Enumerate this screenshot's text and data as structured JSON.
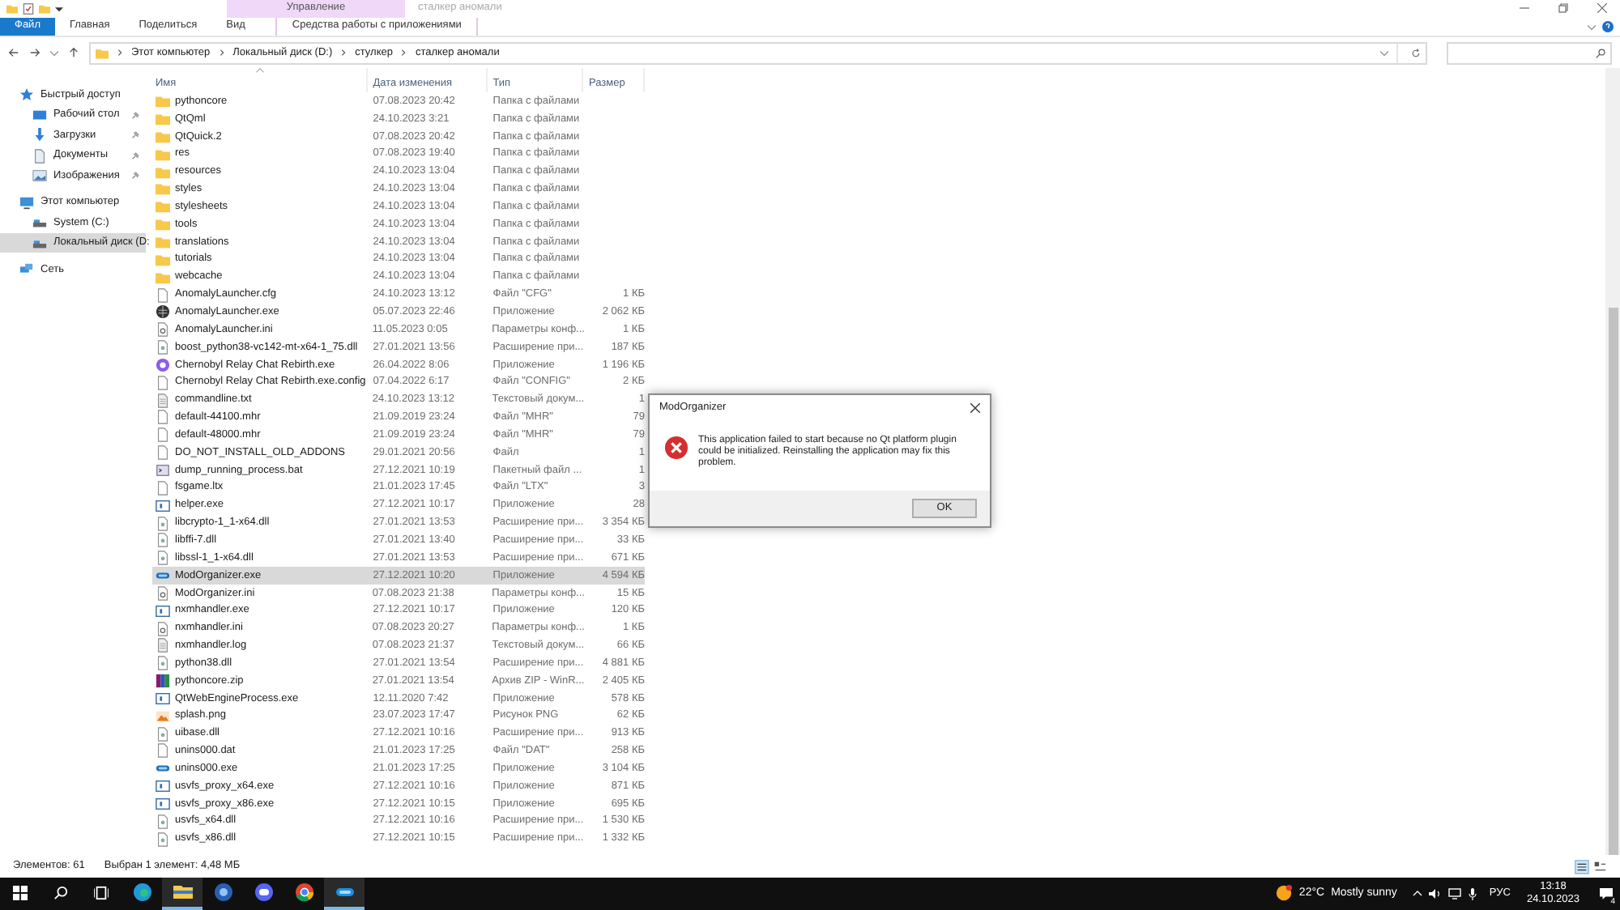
{
  "window": {
    "context_tab": "Управление",
    "title": "сталкер аномали"
  },
  "ribbon": {
    "tabs": [
      {
        "label": "Файл",
        "selected": true
      },
      {
        "label": "Главная",
        "selected": false
      },
      {
        "label": "Поделиться",
        "selected": false
      },
      {
        "label": "Вид",
        "selected": false
      },
      {
        "label": "Средства работы с приложениями",
        "selected": false
      }
    ]
  },
  "address": {
    "crumbs": [
      "Этот компьютер",
      "Локальный диск (D:)",
      "стулкер",
      "сталкер аномали"
    ]
  },
  "sidebar": {
    "items": [
      {
        "label": "Быстрый доступ",
        "kind": "star",
        "pinned": false,
        "selected": false,
        "children": [
          {
            "label": "Рабочий стол",
            "kind": "desktop",
            "pinned": true,
            "selected": false
          },
          {
            "label": "Загрузки",
            "kind": "download",
            "pinned": true,
            "selected": false
          },
          {
            "label": "Документы",
            "kind": "docs",
            "pinned": true,
            "selected": false
          },
          {
            "label": "Изображения",
            "kind": "pictures",
            "pinned": true,
            "selected": false
          }
        ]
      },
      {
        "label": "Этот компьютер",
        "kind": "computer",
        "pinned": false,
        "selected": false,
        "children": [
          {
            "label": "System (C:)",
            "kind": "drive",
            "pinned": false,
            "selected": false
          },
          {
            "label": "Локальный диск (D:",
            "kind": "drive",
            "pinned": false,
            "selected": true
          }
        ]
      },
      {
        "label": "Сеть",
        "kind": "network",
        "pinned": false,
        "selected": false
      }
    ]
  },
  "table": {
    "columns": [
      "Имя",
      "Дата изменения",
      "Тип",
      "Размер"
    ],
    "rows": [
      {
        "name": "pythoncore",
        "date": "07.08.2023 20:42",
        "type": "Папка с файлами",
        "size": "",
        "kind": "folder",
        "selected": false
      },
      {
        "name": "QtQml",
        "date": "24.10.2023 3:21",
        "type": "Папка с файлами",
        "size": "",
        "kind": "folder",
        "selected": false
      },
      {
        "name": "QtQuick.2",
        "date": "07.08.2023 20:42",
        "type": "Папка с файлами",
        "size": "",
        "kind": "folder",
        "selected": false
      },
      {
        "name": "res",
        "date": "07.08.2023 19:40",
        "type": "Папка с файлами",
        "size": "",
        "kind": "folder",
        "selected": false
      },
      {
        "name": "resources",
        "date": "24.10.2023 13:04",
        "type": "Папка с файлами",
        "size": "",
        "kind": "folder",
        "selected": false
      },
      {
        "name": "styles",
        "date": "24.10.2023 13:04",
        "type": "Папка с файлами",
        "size": "",
        "kind": "folder",
        "selected": false
      },
      {
        "name": "stylesheets",
        "date": "24.10.2023 13:04",
        "type": "Папка с файлами",
        "size": "",
        "kind": "folder",
        "selected": false
      },
      {
        "name": "tools",
        "date": "24.10.2023 13:04",
        "type": "Папка с файлами",
        "size": "",
        "kind": "folder",
        "selected": false
      },
      {
        "name": "translations",
        "date": "24.10.2023 13:04",
        "type": "Папка с файлами",
        "size": "",
        "kind": "folder",
        "selected": false
      },
      {
        "name": "tutorials",
        "date": "24.10.2023 13:04",
        "type": "Папка с файлами",
        "size": "",
        "kind": "folder",
        "selected": false
      },
      {
        "name": "webcache",
        "date": "24.10.2023 13:04",
        "type": "Папка с файлами",
        "size": "",
        "kind": "folder",
        "selected": false
      },
      {
        "name": "AnomalyLauncher.cfg",
        "date": "24.10.2023 13:12",
        "type": "Файл \"CFG\"",
        "size": "1 КБ",
        "kind": "file",
        "selected": false
      },
      {
        "name": "AnomalyLauncher.exe",
        "date": "05.07.2023 22:46",
        "type": "Приложение",
        "size": "2 062 КБ",
        "kind": "globe",
        "selected": false
      },
      {
        "name": "AnomalyLauncher.ini",
        "date": "11.05.2023 0:05",
        "type": "Параметры конф...",
        "size": "1 КБ",
        "kind": "settings",
        "selected": false
      },
      {
        "name": "boost_python38-vc142-mt-x64-1_75.dll",
        "date": "27.01.2021 13:56",
        "type": "Расширение при...",
        "size": "187 КБ",
        "kind": "library",
        "selected": false
      },
      {
        "name": "Chernobyl Relay Chat Rebirth.exe",
        "date": "26.04.2022 8:06",
        "type": "Приложение",
        "size": "1 196 КБ",
        "kind": "chat",
        "selected": false
      },
      {
        "name": "Chernobyl Relay Chat Rebirth.exe.config",
        "date": "07.04.2022 6:17",
        "type": "Файл \"CONFIG\"",
        "size": "2 КБ",
        "kind": "file",
        "selected": false
      },
      {
        "name": "commandline.txt",
        "date": "24.10.2023 13:12",
        "type": "Текстовый докум...",
        "size": "1",
        "kind": "text",
        "selected": false
      },
      {
        "name": "default-44100.mhr",
        "date": "21.09.2019 23:24",
        "type": "Файл \"MHR\"",
        "size": "79",
        "kind": "file",
        "selected": false
      },
      {
        "name": "default-48000.mhr",
        "date": "21.09.2019 23:24",
        "type": "Файл \"MHR\"",
        "size": "79",
        "kind": "file",
        "selected": false
      },
      {
        "name": "DO_NOT_INSTALL_OLD_ADDONS",
        "date": "29.01.2021 20:56",
        "type": "Файл",
        "size": "1",
        "kind": "file",
        "selected": false
      },
      {
        "name": "dump_running_process.bat",
        "date": "27.12.2021 10:19",
        "type": "Пакетный файл ...",
        "size": "1",
        "kind": "batch",
        "selected": false
      },
      {
        "name": "fsgame.ltx",
        "date": "21.01.2023 17:45",
        "type": "Файл \"LTX\"",
        "size": "3",
        "kind": "file",
        "selected": false
      },
      {
        "name": "helper.exe",
        "date": "27.12.2021 10:17",
        "type": "Приложение",
        "size": "28",
        "kind": "app",
        "selected": false
      },
      {
        "name": "libcrypto-1_1-x64.dll",
        "date": "27.01.2021 13:53",
        "type": "Расширение при...",
        "size": "3 354 КБ",
        "kind": "library",
        "selected": false
      },
      {
        "name": "libffi-7.dll",
        "date": "27.01.2021 13:40",
        "type": "Расширение при...",
        "size": "33 КБ",
        "kind": "library",
        "selected": false
      },
      {
        "name": "libssl-1_1-x64.dll",
        "date": "27.01.2021 13:53",
        "type": "Расширение при...",
        "size": "671 КБ",
        "kind": "library",
        "selected": false
      },
      {
        "name": "ModOrganizer.exe",
        "date": "27.12.2021 10:20",
        "type": "Приложение",
        "size": "4 594 КБ",
        "kind": "organizer",
        "selected": true
      },
      {
        "name": "ModOrganizer.ini",
        "date": "07.08.2023 21:38",
        "type": "Параметры конф...",
        "size": "15 КБ",
        "kind": "settings",
        "selected": false
      },
      {
        "name": "nxmhandler.exe",
        "date": "27.12.2021 10:17",
        "type": "Приложение",
        "size": "120 КБ",
        "kind": "app",
        "selected": false
      },
      {
        "name": "nxmhandler.ini",
        "date": "07.08.2023 20:27",
        "type": "Параметры конф...",
        "size": "1 КБ",
        "kind": "settings",
        "selected": false
      },
      {
        "name": "nxmhandler.log",
        "date": "07.08.2023 21:37",
        "type": "Текстовый докум...",
        "size": "66 КБ",
        "kind": "text",
        "selected": false
      },
      {
        "name": "python38.dll",
        "date": "27.01.2021 13:54",
        "type": "Расширение при...",
        "size": "4 881 КБ",
        "kind": "library",
        "selected": false
      },
      {
        "name": "pythoncore.zip",
        "date": "27.01.2021 13:54",
        "type": "Архив ZIP - WinR...",
        "size": "2 405 КБ",
        "kind": "archive",
        "selected": false
      },
      {
        "name": "QtWebEngineProcess.exe",
        "date": "12.11.2020 7:42",
        "type": "Приложение",
        "size": "578 КБ",
        "kind": "app",
        "selected": false
      },
      {
        "name": "splash.png",
        "date": "23.07.2023 17:47",
        "type": "Рисунок PNG",
        "size": "62 КБ",
        "kind": "image",
        "selected": false
      },
      {
        "name": "uibase.dll",
        "date": "27.12.2021 10:16",
        "type": "Расширение при...",
        "size": "913 КБ",
        "kind": "library",
        "selected": false
      },
      {
        "name": "unins000.dat",
        "date": "21.01.2023 17:25",
        "type": "Файл \"DAT\"",
        "size": "258 КБ",
        "kind": "file",
        "selected": false
      },
      {
        "name": "unins000.exe",
        "date": "21.01.2023 17:25",
        "type": "Приложение",
        "size": "3 104 КБ",
        "kind": "organizer",
        "selected": false
      },
      {
        "name": "usvfs_proxy_x64.exe",
        "date": "27.12.2021 10:16",
        "type": "Приложение",
        "size": "871 КБ",
        "kind": "app",
        "selected": false
      },
      {
        "name": "usvfs_proxy_x86.exe",
        "date": "27.12.2021 10:15",
        "type": "Приложение",
        "size": "695 КБ",
        "kind": "app",
        "selected": false
      },
      {
        "name": "usvfs_x64.dll",
        "date": "27.12.2021 10:16",
        "type": "Расширение при...",
        "size": "1 530 КБ",
        "kind": "library",
        "selected": false
      },
      {
        "name": "usvfs_x86.dll",
        "date": "27.12.2021 10:15",
        "type": "Расширение при...",
        "size": "1 332 КБ",
        "kind": "library",
        "selected": false
      }
    ]
  },
  "status_bar": {
    "count": "Элементов: 61",
    "selection": "Выбран 1 элемент: 4,48 МБ"
  },
  "dialog": {
    "title": "ModOrganizer",
    "message": "This application failed to start because no Qt platform plugin could be initialized. Reinstalling the application may fix this problem.",
    "button": "OK"
  },
  "taskbar": {
    "apps": [
      {
        "kind": "edge",
        "active": false
      },
      {
        "kind": "explorer",
        "active": true
      },
      {
        "kind": "orb",
        "active": false
      },
      {
        "kind": "chat",
        "active": false
      },
      {
        "kind": "chrome",
        "active": false
      },
      {
        "kind": "organizer",
        "active": true
      }
    ],
    "weather": {
      "temp": "22°C",
      "text": "Mostly sunny"
    },
    "language": "РУС",
    "time": "13:18",
    "date": "24.10.2023",
    "notifications": "4"
  }
}
